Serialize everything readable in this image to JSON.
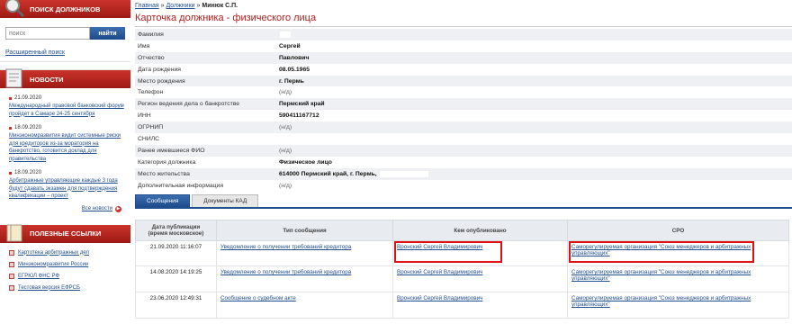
{
  "sidebar": {
    "search_title": "ПОИСК ДОЛЖНИКОВ",
    "search_placeholder": "поиск",
    "search_button": "найти",
    "advanced_search": "Расширенный поиск",
    "news_title": "НОВОСТИ",
    "news": [
      {
        "date": "21.09.2020",
        "text": "Международный правовой банковский форум пройдет в Самаре 24-25 сентября"
      },
      {
        "date": "18.09.2020",
        "text": "Минэкономразвития видит системные риски для кредиторов из-за моратория на банкротство, готовится доклад для правительства"
      },
      {
        "date": "18.09.2020",
        "text": "Арбитражные управляющие каждые 3 года будут сдавать экзамен для подтверждения квалификации – проект"
      }
    ],
    "all_news": "Все новости",
    "links_title": "ПОЛЕЗНЫЕ ССЫЛКИ",
    "links": [
      "Картотека арбитражных дел",
      "Минэкономразвития России",
      "ЕГРЮЛ ФНС РФ",
      "Тестовая версия ЕФРСБ"
    ]
  },
  "breadcrumb": {
    "home": "Главная",
    "sep": "»",
    "debtors": "Должники",
    "current": "Минюк С.П."
  },
  "page_title": "Карточка должника - физического лица",
  "info_rows": [
    {
      "label": "Фамилия",
      "value": "",
      "blank": true
    },
    {
      "label": "Имя",
      "value": "Сергей"
    },
    {
      "label": "Отчество",
      "value": "Павлович"
    },
    {
      "label": "Дата рождения",
      "value": "08.05.1965"
    },
    {
      "label": "Место рождения",
      "value": "г. Пермь"
    },
    {
      "label": "Телефон",
      "value": "(н/д)",
      "nd": true
    },
    {
      "label": "Регион ведения дела о банкротстве",
      "value": "Пермский край"
    },
    {
      "label": "ИНН",
      "value": "590411167712"
    },
    {
      "label": "ОГРНИП",
      "value": "(н/д)",
      "nd": true
    },
    {
      "label": "СНИЛС",
      "value": ""
    },
    {
      "label": "Ранее имевшиеся ФИО",
      "value": "(н/д)",
      "nd": true
    },
    {
      "label": "Категория должника",
      "value": "Физическое лицо"
    },
    {
      "label": "Место жительства",
      "value": "614000 Пермский край, г. Пермь,"
    },
    {
      "label": "Дополнительная информация",
      "value": "(н/д)",
      "nd": true
    }
  ],
  "tabs": [
    "Сообщения",
    "Документы КАД"
  ],
  "table": {
    "headers": [
      "Дата публикации\n(время московское)",
      "Тип сообщения",
      "Кем опубликовано",
      "СРО"
    ],
    "rows": [
      {
        "date": "21.09.2020 11:16:07",
        "type": "Уведомление о получении требований кредитора",
        "publisher": "Вронский Сергей Владимирович",
        "sro": "Саморегулируемая организация \"Союз менеджеров и арбитражных управляющих\""
      },
      {
        "date": "14.08.2020 14:19:25",
        "type": "Уведомление о получении требований кредитора",
        "publisher": "Вронский Сергей Владимирович",
        "sro": "Саморегулируемая организация \"Союз менеджеров и арбитражных управляющих\""
      },
      {
        "date": "23.06.2020 12:49:31",
        "type": "Сообщение о судебном акте",
        "publisher": "Вронский Сергей Владимирович",
        "sro": "Саморегулируемая организация \"Союз менеджеров и арбитражных управляющих\""
      }
    ]
  },
  "colors": {
    "accent_red": "#b51c1c",
    "header_red": "#c9332b",
    "blue": "#1d4a8a",
    "highlight": "#dd1111"
  }
}
